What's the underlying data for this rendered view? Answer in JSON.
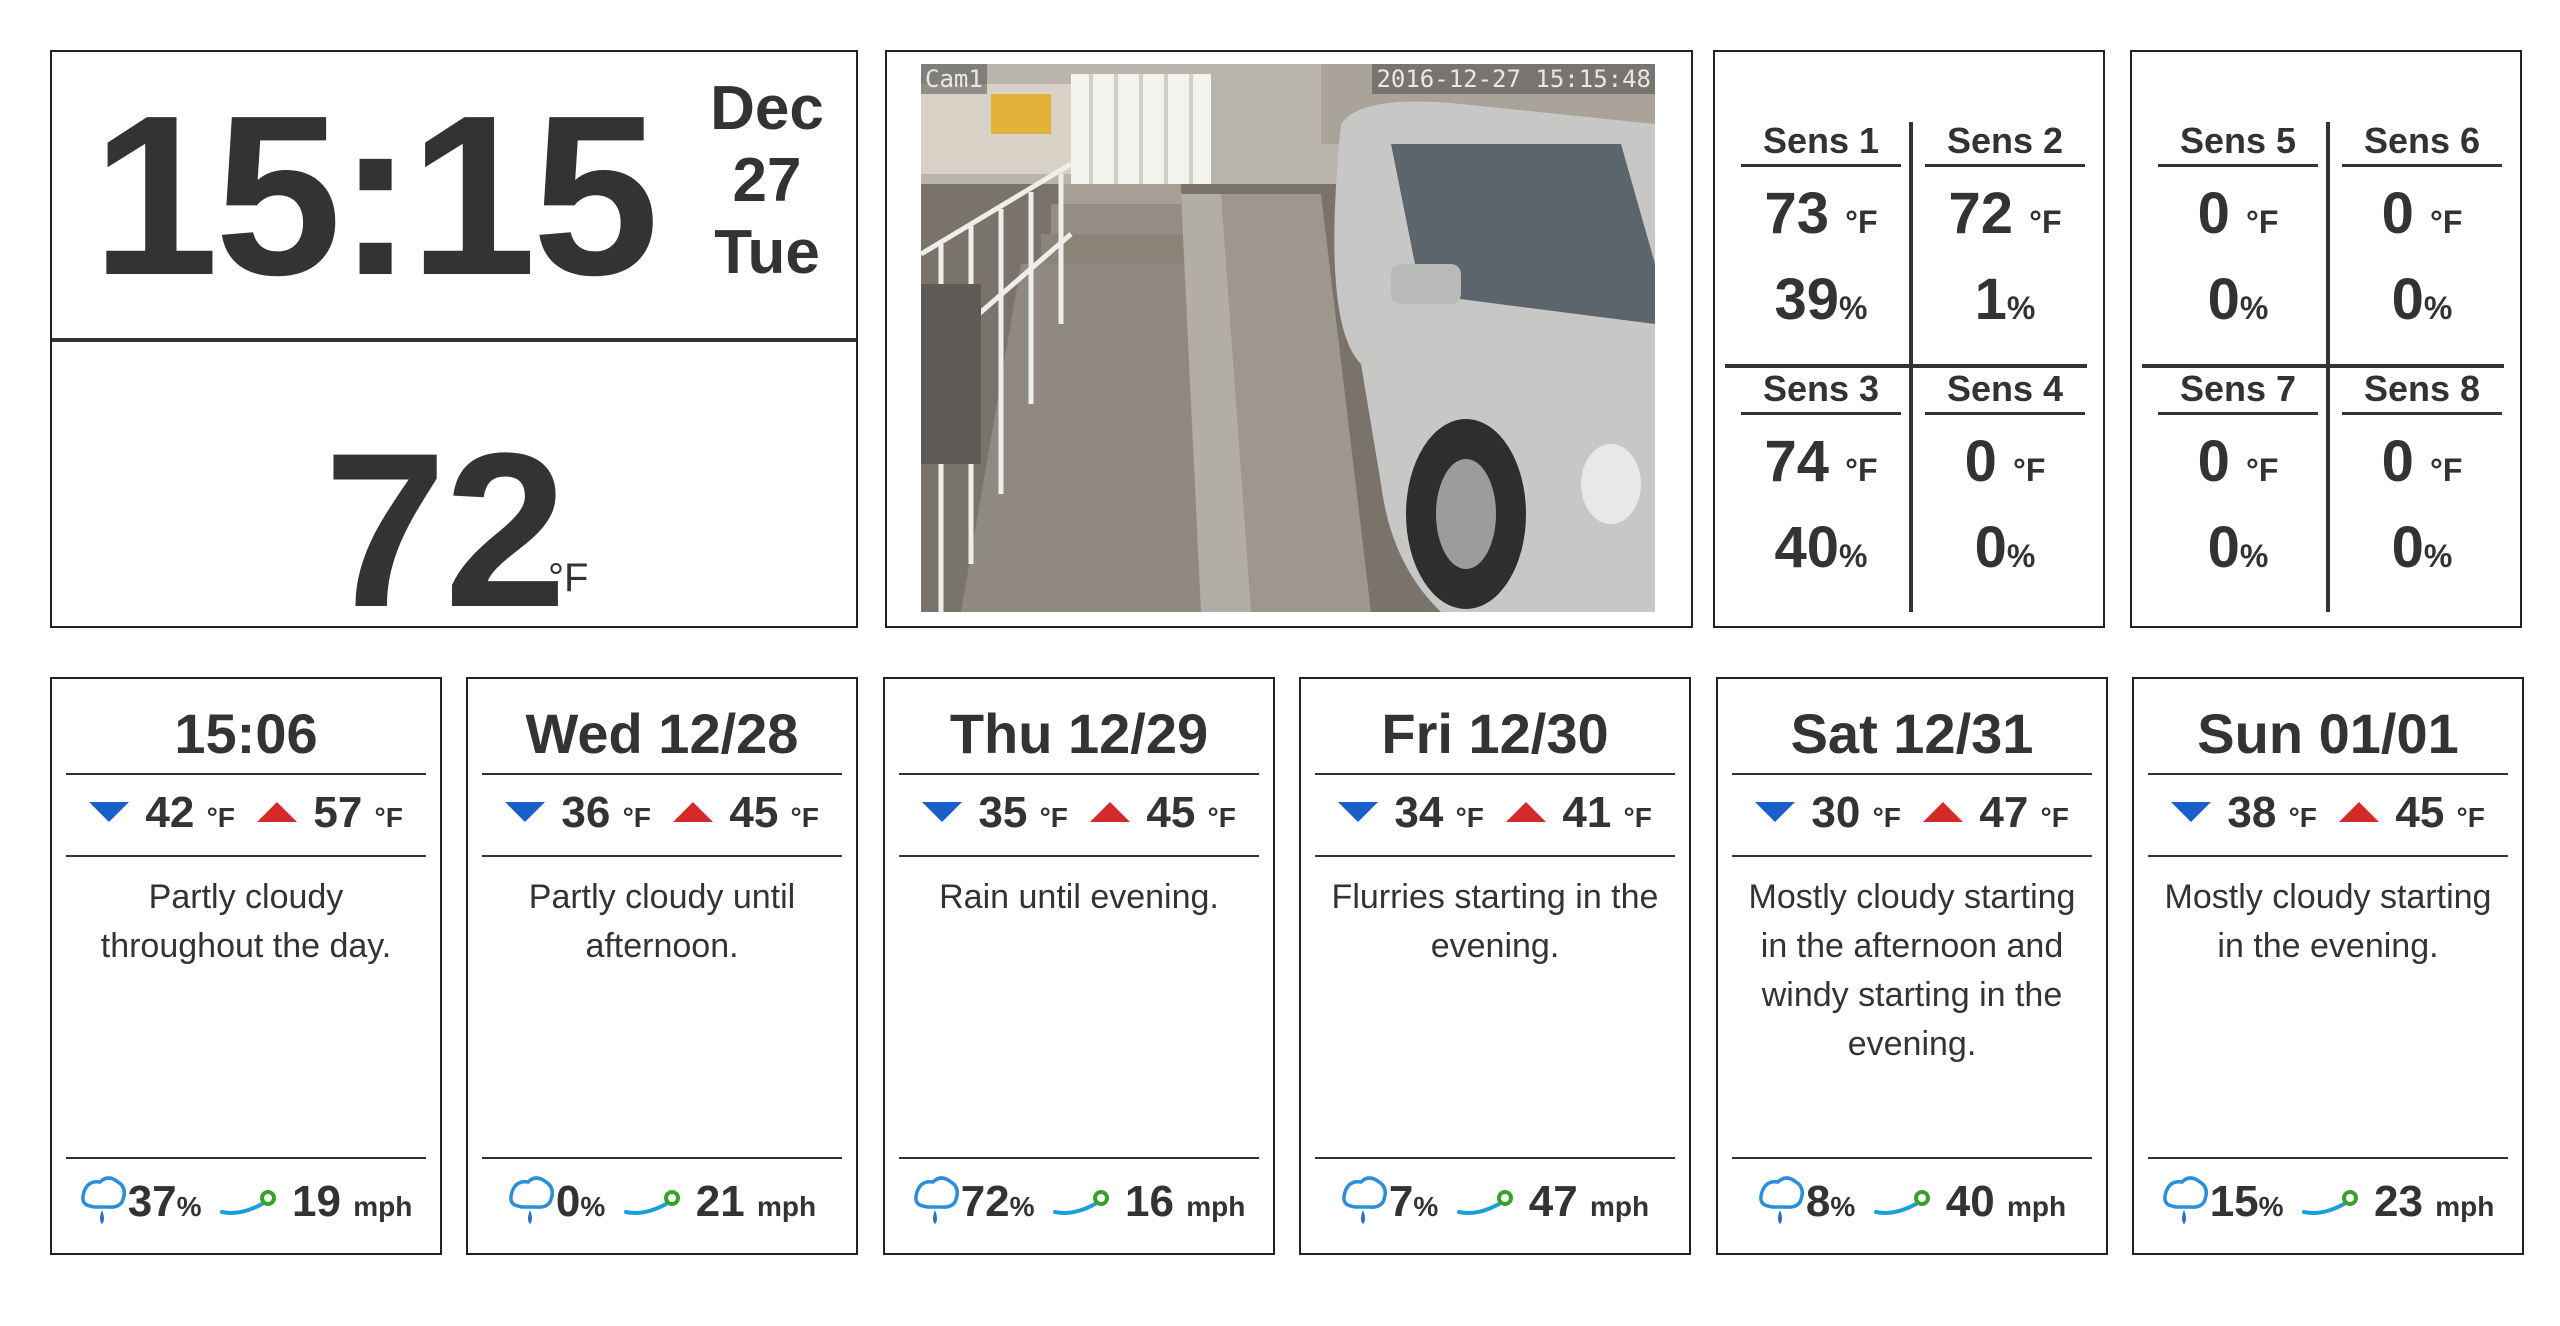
{
  "clock": {
    "time": "15:15",
    "month": "Dec",
    "day": "27",
    "weekday": "Tue"
  },
  "current": {
    "temp": "72",
    "unit": "°F"
  },
  "camera": {
    "label": "Cam1",
    "timestamp": "2016-12-27 15:15:48"
  },
  "sensor_panels": [
    {
      "sensors": [
        {
          "name": "Sens 1",
          "temp": "73",
          "hum": "39"
        },
        {
          "name": "Sens 2",
          "temp": "72",
          "hum": "1"
        },
        {
          "name": "Sens 3",
          "temp": "74",
          "hum": "40"
        },
        {
          "name": "Sens 4",
          "temp": "0",
          "hum": "0"
        }
      ]
    },
    {
      "sensors": [
        {
          "name": "Sens 5",
          "temp": "0",
          "hum": "0"
        },
        {
          "name": "Sens 6",
          "temp": "0",
          "hum": "0"
        },
        {
          "name": "Sens 7",
          "temp": "0",
          "hum": "0"
        },
        {
          "name": "Sens 8",
          "temp": "0",
          "hum": "0"
        }
      ]
    }
  ],
  "units": {
    "temp": "°F",
    "percent": "%",
    "wind": "mph"
  },
  "forecast": [
    {
      "title": "15:06",
      "low": "42",
      "high": "57",
      "summary": "Partly cloudy throughout the day.",
      "precip": "37",
      "wind": "19"
    },
    {
      "title": "Wed 12/28",
      "low": "36",
      "high": "45",
      "summary": "Partly cloudy until afternoon.",
      "precip": "0",
      "wind": "21"
    },
    {
      "title": "Thu 12/29",
      "low": "35",
      "high": "45",
      "summary": "Rain until evening.",
      "precip": "72",
      "wind": "16"
    },
    {
      "title": "Fri 12/30",
      "low": "34",
      "high": "41",
      "summary": "Flurries starting in the evening.",
      "precip": "7",
      "wind": "47"
    },
    {
      "title": "Sat 12/31",
      "low": "30",
      "high": "47",
      "summary": "Mostly cloudy starting in the afternoon and windy starting in the evening.",
      "precip": "8",
      "wind": "40"
    },
    {
      "title": "Sun 01/01",
      "low": "38",
      "high": "45",
      "summary": "Mostly cloudy starting in the evening.",
      "precip": "15",
      "wind": "23"
    }
  ],
  "colors": {
    "low_arrow": "#1a5fc9",
    "high_arrow": "#d42a2a",
    "rain_icon": "#2a8fd8",
    "wind_icon": "#1aa0d8",
    "wind_leaf": "#3aa02a"
  },
  "icons": {
    "low": "triangle-down-icon",
    "high": "triangle-up-icon",
    "precip": "raincloud-icon",
    "wind": "wind-icon"
  }
}
